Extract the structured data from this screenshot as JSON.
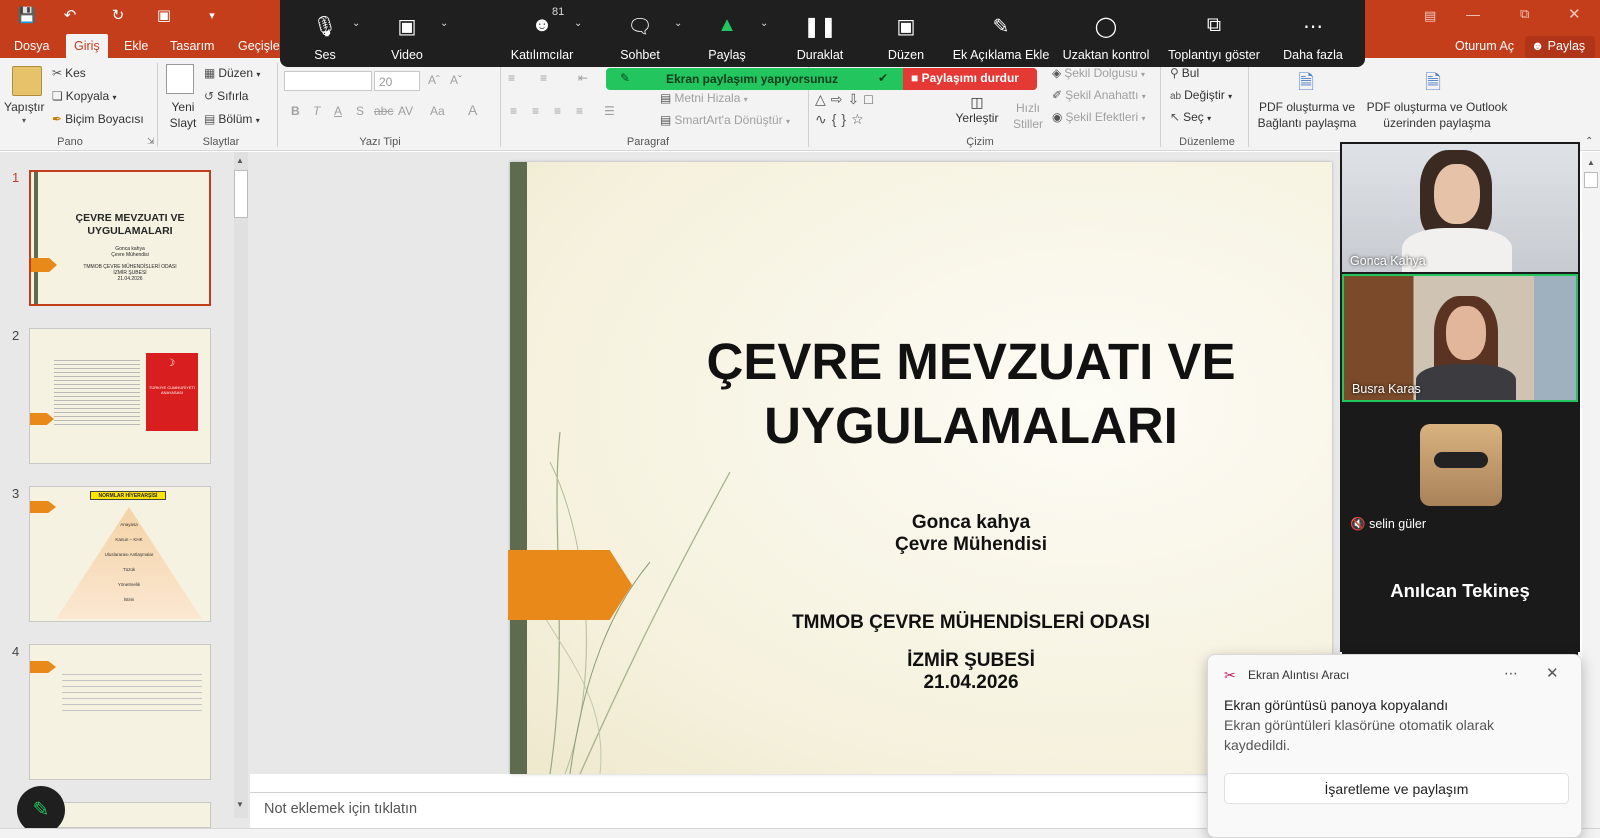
{
  "quick_access": {
    "undo_icon": "undo-icon",
    "redo_icon": "redo-icon"
  },
  "tabs": [
    "Dosya",
    "Giriş",
    "Ekle",
    "Tasarım",
    "Geçişler"
  ],
  "titlebar_right": {
    "open_label": "Oturum Aç",
    "share_label": "Paylaş"
  },
  "ribbon": {
    "pano": {
      "label": "Pano",
      "paste": "Yapıştır",
      "cut": "Kes",
      "copy": "Kopyala",
      "format_painter": "Biçim Boyacısı"
    },
    "slaytlar": {
      "label": "Slaytlar",
      "new_slide": "Yeni Slayt",
      "layout": "Düzen",
      "reset": "Sıfırla",
      "section": "Bölüm"
    },
    "yazi_tipi": {
      "label": "Yazı Tipi",
      "font_size": "20"
    },
    "paragraf": {
      "label": "Paragraf",
      "align_text": "Metni Hizala",
      "smartart": "SmartArt'a Dönüştür"
    },
    "cizim": {
      "label": "Çizim",
      "arrange": "Yerleştir",
      "quick_styles": "Hızlı Stiller",
      "shape_fill": "Şekil Dolgusu",
      "shape_outline": "Şekil Anahattı",
      "shape_effects": "Şekil Efektleri"
    },
    "duzenleme": {
      "label": "Düzenleme",
      "find": "Bul",
      "replace": "Değiştir",
      "select": "Seç"
    },
    "pdf": {
      "pdf_link": "PDF oluşturma ve Bağlantı paylaşma",
      "pdf_outlook": "PDF oluşturma ve Outlook üzerinden paylaşma"
    }
  },
  "zoom_toolbar": {
    "participant_count": "81",
    "items": [
      {
        "label": "Ses",
        "icon": "microphone-icon"
      },
      {
        "label": "Video",
        "icon": "video-camera-icon"
      },
      {
        "label": "Katılımcılar",
        "icon": "participants-icon"
      },
      {
        "label": "Sohbet",
        "icon": "chat-icon"
      },
      {
        "label": "Paylaş",
        "icon": "share-screen-icon"
      },
      {
        "label": "Duraklat",
        "icon": "pause-icon"
      },
      {
        "label": "Düzen",
        "icon": "annotate-layout-icon"
      },
      {
        "label": "Ek Açıklama Ekle",
        "icon": "pencil-icon"
      },
      {
        "label": "Uzaktan kontrol",
        "icon": "mouse-icon"
      },
      {
        "label": "Toplantıyı göster",
        "icon": "show-meeting-icon"
      },
      {
        "label": "Daha fazla",
        "icon": "more-icon"
      }
    ],
    "sharing_text": "Ekran paylaşımı yapıyorsunuz",
    "stop_label": "Paylaşımı durdur"
  },
  "thumbnails": [
    {
      "num": "1",
      "title": "ÇEVRE MEVZUATI VE UYGULAMALARI",
      "sub1": "Gonca kahya",
      "sub2": "Çevre Mühendisi",
      "sub3": "TMMOB ÇEVRE MÜHENDİSLERİ ODASI",
      "sub4": "İZMİR ŞUBESİ",
      "sub5": "21.04.2026"
    },
    {
      "num": "2",
      "book": "TÜRKİYE CUMHURİYETİ ANAYASASI"
    },
    {
      "num": "3",
      "header": "NORMLAR HİYERARŞİSİ",
      "levels": [
        "Anayasa",
        "Kanun – KHK",
        "Uluslararası Antlaşmalar",
        "Tüzük",
        "Yönetmelik",
        "İstimi"
      ]
    },
    {
      "num": "4"
    }
  ],
  "slide": {
    "title_line1": "ÇEVRE MEVZUATI VE",
    "title_line2": "UYGULAMALARI",
    "author": "Gonca kahya",
    "role": "Çevre Mühendisi",
    "org": "TMMOB ÇEVRE MÜHENDİSLERİ ODASI",
    "branch": "İZMİR ŞUBESİ",
    "date": "21.04.2026",
    "accent_color": "#e8891a"
  },
  "notes_placeholder": "Not eklemek için tıklatın",
  "participants": [
    {
      "name": "Gonca Kahya"
    },
    {
      "name": "Busra Karas"
    },
    {
      "name": "selin güler",
      "muted_icon": "muted-mic-icon"
    },
    {
      "name": "Anılcan Tekineş"
    }
  ],
  "toast": {
    "app": "Ekran Alıntısı Aracı",
    "title": "Ekran görüntüsü panoya kopyalandı",
    "body": "Ekran görüntüleri klasörüne otomatik olarak kaydedildi.",
    "button": "İşaretleme ve paylaşım"
  }
}
